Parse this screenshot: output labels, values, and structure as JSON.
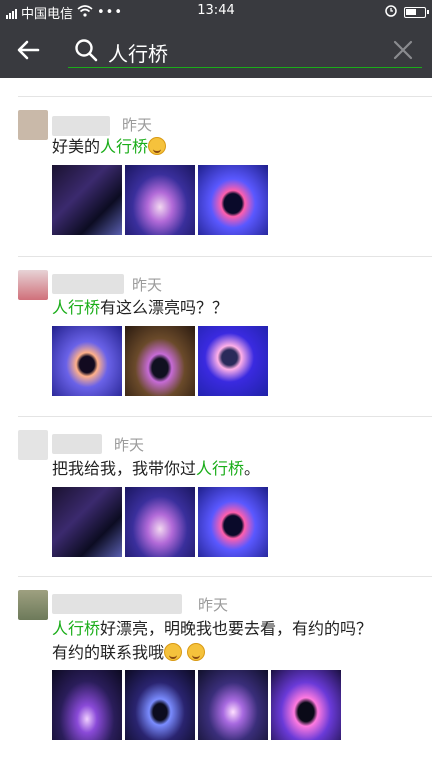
{
  "statusbar": {
    "carrier": "中国电信",
    "signal_label": "4G",
    "time": "13:44"
  },
  "search": {
    "query": "人行桥"
  },
  "highlight_color": "#1aad19",
  "posts": [
    {
      "date": "昨天",
      "text_before": "好美的",
      "keyword": "人行桥",
      "text_after": "",
      "line2": ""
    },
    {
      "date": "昨天",
      "text_before": "",
      "keyword": "人行桥",
      "text_after": "有这么漂亮吗？？",
      "line2": ""
    },
    {
      "date": "昨天",
      "text_before": "把我给我，我带你过",
      "keyword": "人行桥",
      "text_after": "。",
      "line2": ""
    },
    {
      "date": "昨天",
      "text_before": "",
      "keyword": "人行桥",
      "text_after": "好漂亮，明晚我也要去看，有约的吗？",
      "line2": "有约的联系我哦"
    }
  ]
}
